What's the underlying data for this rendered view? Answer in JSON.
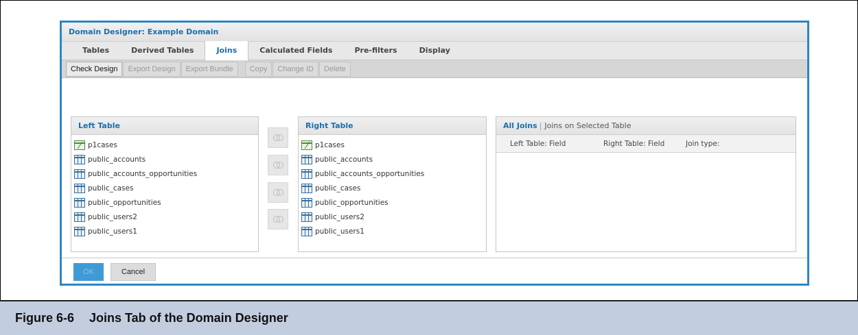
{
  "dialog": {
    "title": "Domain Designer: Example Domain"
  },
  "tabs": [
    {
      "label": "Tables",
      "active": false
    },
    {
      "label": "Derived Tables",
      "active": false
    },
    {
      "label": "Joins",
      "active": true
    },
    {
      "label": "Calculated Fields",
      "active": false
    },
    {
      "label": "Pre-filters",
      "active": false
    },
    {
      "label": "Display",
      "active": false
    }
  ],
  "toolbar": {
    "check_design": "Check Design",
    "export_design": "Export Design",
    "export_bundle": "Export Bundle",
    "copy": "Copy",
    "change_id": "Change ID",
    "delete": "Delete"
  },
  "left_table": {
    "title": "Left Table",
    "items": [
      {
        "name": "p1cases",
        "icon": "derived-table-icon"
      },
      {
        "name": "public_accounts",
        "icon": "table-icon"
      },
      {
        "name": "public_accounts_opportunities",
        "icon": "table-icon"
      },
      {
        "name": "public_cases",
        "icon": "table-icon"
      },
      {
        "name": "public_opportunities",
        "icon": "table-icon"
      },
      {
        "name": "public_users2",
        "icon": "table-icon"
      },
      {
        "name": "public_users1",
        "icon": "table-icon"
      }
    ]
  },
  "join_buttons": [
    "inner-join-icon",
    "left-outer-join-icon",
    "right-outer-join-icon",
    "full-outer-join-icon"
  ],
  "right_table": {
    "title": "Right Table",
    "items": [
      {
        "name": "p1cases",
        "icon": "derived-table-icon"
      },
      {
        "name": "public_accounts",
        "icon": "table-icon"
      },
      {
        "name": "public_accounts_opportunities",
        "icon": "table-icon"
      },
      {
        "name": "public_cases",
        "icon": "table-icon"
      },
      {
        "name": "public_opportunities",
        "icon": "table-icon"
      },
      {
        "name": "public_users2",
        "icon": "table-icon"
      },
      {
        "name": "public_users1",
        "icon": "table-icon"
      }
    ]
  },
  "joins_panel": {
    "all_joins": "All Joins",
    "separator": "|",
    "selected": "Joins on Selected Table",
    "columns": [
      "Left Table: Field",
      "Right Table: Field",
      "Join type:"
    ]
  },
  "footer": {
    "ok": "OK",
    "cancel": "Cancel"
  },
  "caption": {
    "number": "Figure 6-6",
    "title": "Joins Tab of the Domain Designer"
  }
}
